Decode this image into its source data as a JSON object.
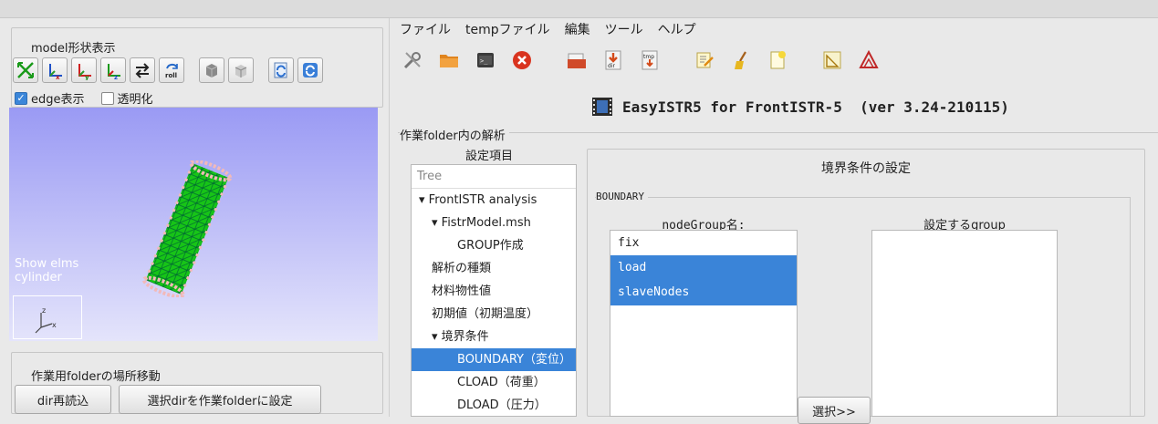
{
  "menu": [
    "ファイル",
    "tempファイル",
    "編集",
    "ツール",
    "ヘルプ"
  ],
  "left": {
    "model_group_title": "model形状表示",
    "view_buttons": [
      {
        "name": "fit-view-icon"
      },
      {
        "name": "view-x-axis-icon",
        "label": "x"
      },
      {
        "name": "view-y-axis-icon",
        "label": "y"
      },
      {
        "name": "view-z-axis-icon",
        "label": "z"
      },
      {
        "name": "swap-arrows-icon"
      },
      {
        "name": "roll-icon",
        "label": "roll"
      }
    ],
    "edge_label": "edge表示",
    "transparent_label": "透明化",
    "viewport_text_1": "Show elms",
    "viewport_text_2": "cylinder",
    "folder_group_title": "作業用folderの場所移動",
    "reload_dir_button": "dir再読込",
    "set_dir_button": "選択dirを作業folderに設定"
  },
  "app": {
    "title": "EasyISTR5 for FrontISTR-5  (ver 3.24-210115)"
  },
  "analysis": {
    "group_title": "作業folder内の解析",
    "settings_header": "設定項目",
    "tree_header": "Tree",
    "tree": [
      {
        "label": "▾ FrontISTR analysis",
        "indent": 0
      },
      {
        "label": "▾ FistrModel.msh",
        "indent": 1
      },
      {
        "label": "GROUP作成",
        "indent": 3
      },
      {
        "label": "解析の種類",
        "indent": 1
      },
      {
        "label": "材料物性値",
        "indent": 1
      },
      {
        "label": "初期値（初期温度）",
        "indent": 1
      },
      {
        "label": "▾ 境界条件",
        "indent": 1
      },
      {
        "label": "BOUNDARY（変位）",
        "indent": 3,
        "selected": true
      },
      {
        "label": "CLOAD（荷重）",
        "indent": 3
      },
      {
        "label": "DLOAD（圧力）",
        "indent": 3
      }
    ]
  },
  "boundary": {
    "title": "境界条件の設定",
    "group_title": "BOUNDARY",
    "nodegroup_header": "nodeGroup名:",
    "target_header": "設定するgroup",
    "nodegroups": [
      {
        "label": "fix",
        "selected": false
      },
      {
        "label": "load",
        "selected": true
      },
      {
        "label": "slaveNodes",
        "selected": true
      }
    ],
    "select_button": "選択>>"
  },
  "colors": {
    "selection": "#3a84d8",
    "viewport_top": "#9a9af4",
    "viewport_bottom": "#e4e4fb",
    "mesh": "#17c417",
    "mesh_nodes": "#f2b9b9"
  }
}
